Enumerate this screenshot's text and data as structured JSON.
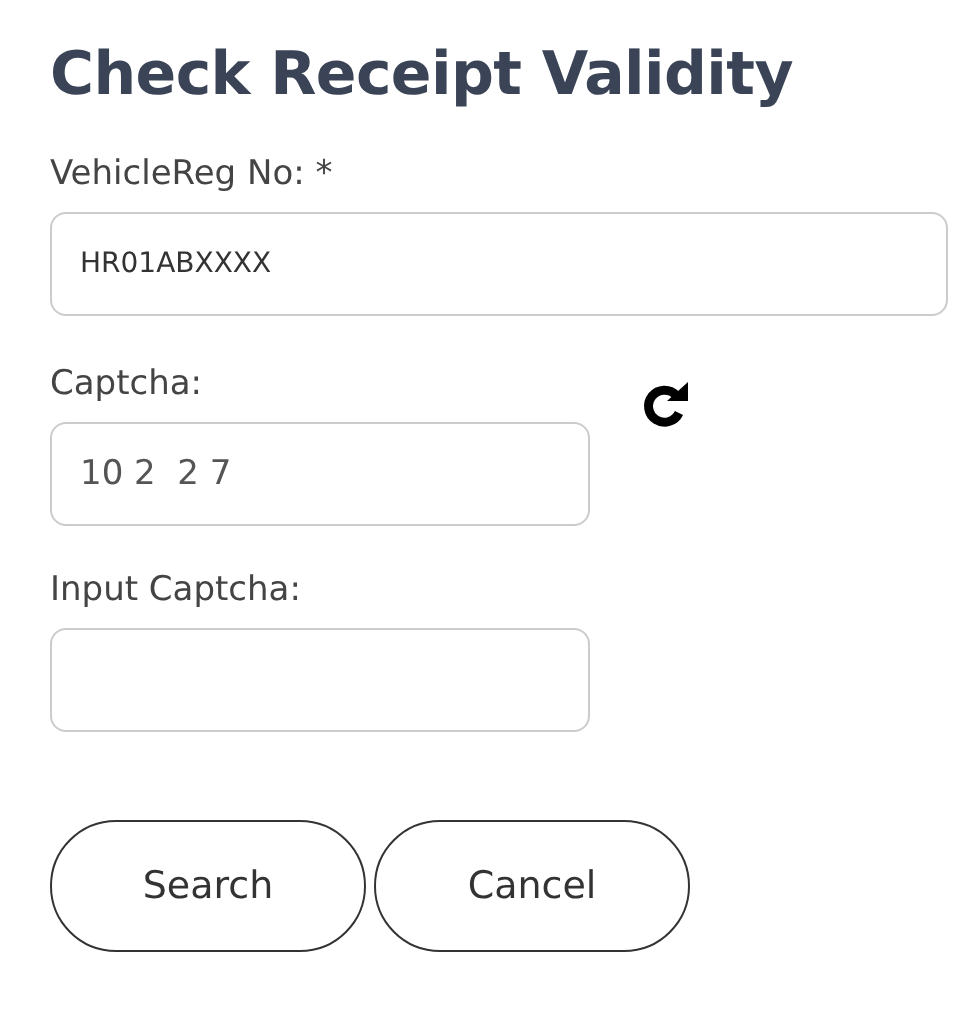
{
  "title": "Check Receipt Validity",
  "fields": [
    {
      "kind": "text",
      "label": "VehicleReg No: *",
      "value": "HR01ABXXXX"
    },
    {
      "kind": "captcha",
      "label": "Captcha:",
      "value": "10 2  2 7"
    },
    {
      "kind": "input",
      "label": "Input Captcha:"
    }
  ],
  "buttons": [
    "Search",
    "Cancel"
  ]
}
